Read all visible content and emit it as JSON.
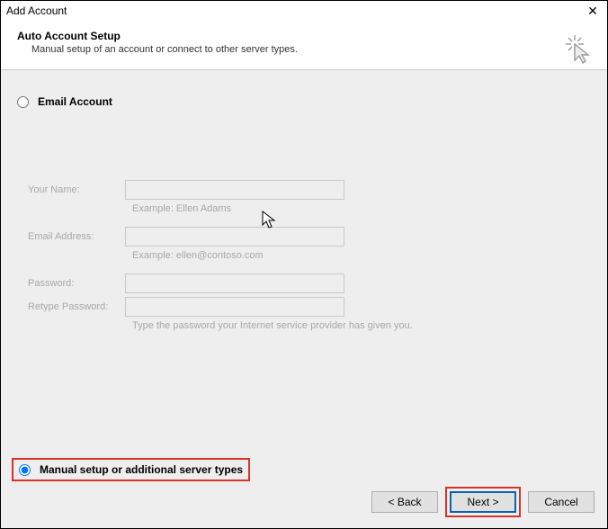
{
  "window": {
    "title": "Add Account"
  },
  "header": {
    "title": "Auto Account Setup",
    "subtitle": "Manual setup of an account or connect to other server types."
  },
  "options": {
    "email_account": {
      "label": "Email Account",
      "selected": false
    },
    "manual_setup": {
      "label": "Manual setup or additional server types",
      "selected": true
    }
  },
  "form": {
    "your_name": {
      "label": "Your Name:",
      "value": "",
      "hint": "Example: Ellen Adams"
    },
    "email": {
      "label": "Email Address:",
      "value": "",
      "hint": "Example: ellen@contoso.com"
    },
    "password": {
      "label": "Password:",
      "value": ""
    },
    "retype_password": {
      "label": "Retype Password:",
      "value": "",
      "hint": "Type the password your Internet service provider has given you."
    }
  },
  "buttons": {
    "back": "< Back",
    "next": "Next >",
    "cancel": "Cancel"
  },
  "icons": {
    "close": "✕"
  }
}
